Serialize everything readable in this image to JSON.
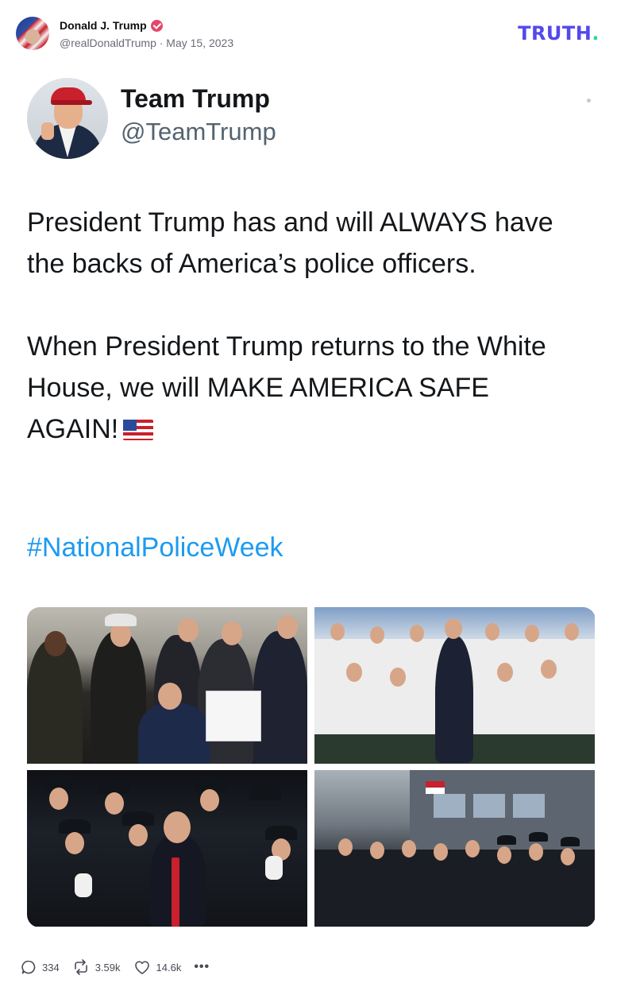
{
  "post": {
    "author_name": "Donald J. Trump",
    "meta": "@realDonaldTrump · May 15, 2023",
    "brand": "TRUTH",
    "brand_dot": "."
  },
  "embed": {
    "name": "Team Trump",
    "handle": "@TeamTrump",
    "paragraph1": "President Trump has and will ALWAYS have the backs of America’s police officers.",
    "paragraph2": "When President Trump returns to the White House, we will MAKE AMERICA SAFE AGAIN!",
    "flag_icon": "us-flag-icon",
    "hashtag": "#NationalPoliceWeek"
  },
  "photos": [
    {
      "name": "photo-bill-signing"
    },
    {
      "name": "photo-group-air-force-one"
    },
    {
      "name": "photo-officers-applause"
    },
    {
      "name": "photo-street-crowd"
    }
  ],
  "actions": {
    "replies": "334",
    "reposts": "3.59k",
    "likes": "14.6k",
    "more": "•••"
  },
  "colors": {
    "brand": "#5448ee",
    "brand_dot": "#26d6a5",
    "verified": "#e5466b",
    "hashtag": "#1d9bf0",
    "handle": "#536471"
  }
}
